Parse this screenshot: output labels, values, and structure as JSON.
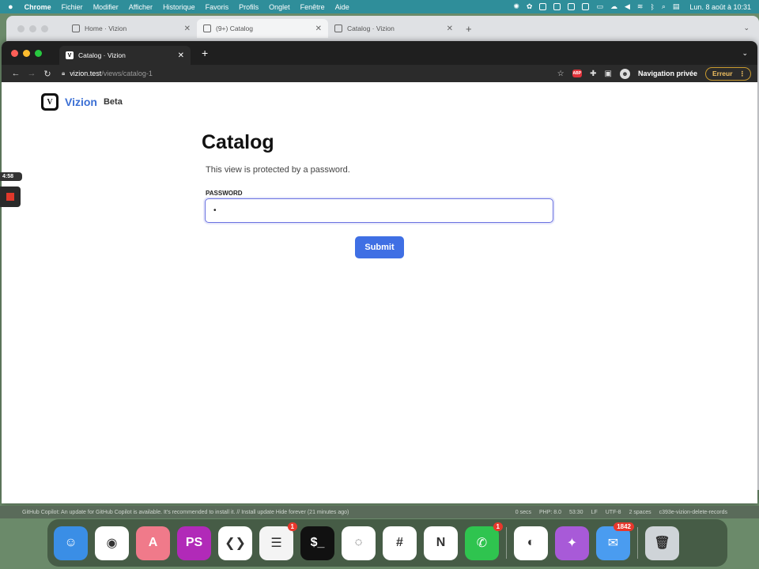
{
  "menubar": {
    "app": "Chrome",
    "items": [
      "Fichier",
      "Modifier",
      "Afficher",
      "Historique",
      "Favoris",
      "Profils",
      "Onglet",
      "Fenêtre",
      "Aide"
    ],
    "clock": "Lun. 8 août à 10:31"
  },
  "back_window": {
    "tabs": [
      {
        "label": "Home · Vizion"
      },
      {
        "label": "(9+) Catalog"
      },
      {
        "label": "Catalog · Vizion"
      }
    ]
  },
  "browser": {
    "tab_label": "Catalog · Vizion",
    "tab_favicon": "V",
    "url_host": "vizion.test",
    "url_path": "/views/catalog-1",
    "abp_label": "ABP",
    "profile_label": "Navigation privée",
    "error_label": "Erreur"
  },
  "page": {
    "brand_logo": "V",
    "brand_name": "Vizion",
    "brand_badge": "Beta",
    "title": "Catalog",
    "description": "This view is protected by a password.",
    "password_label": "PASSWORD",
    "password_value": "•",
    "submit_label": "Submit"
  },
  "recorder": {
    "time": "4:58"
  },
  "ide_status": {
    "message": "GitHub Copilot: An update for GitHub Copilot is available. It's recommended to install it. // Install update   Hide forever (21 minutes ago)",
    "items": [
      "0 secs",
      "PHP: 8.0",
      "53:30",
      "LF",
      "UTF-8",
      "2 spaces",
      "c393e-vizion-delete-records"
    ]
  },
  "dock": {
    "apps": [
      {
        "name": "finder",
        "color": "#3a8ee6",
        "glyph": "☺"
      },
      {
        "name": "chrome",
        "color": "#ffffff",
        "glyph": "◉"
      },
      {
        "name": "appstore-a",
        "color": "#f07a8a",
        "glyph": "A"
      },
      {
        "name": "phpstorm",
        "color": "#b12ab8",
        "glyph": "PS"
      },
      {
        "name": "vscode",
        "color": "#ffffff",
        "glyph": "❮❯"
      },
      {
        "name": "reminders",
        "color": "#f4f4f4",
        "glyph": "☰",
        "badge": "1"
      },
      {
        "name": "terminal",
        "color": "#111111",
        "glyph": "$_"
      },
      {
        "name": "messenger",
        "color": "#ffffff",
        "glyph": "◌"
      },
      {
        "name": "slack",
        "color": "#ffffff",
        "glyph": "#"
      },
      {
        "name": "notion",
        "color": "#ffffff",
        "glyph": "N"
      },
      {
        "name": "whatsapp",
        "color": "#2fc44f",
        "glyph": "✆",
        "badge": "1"
      },
      {
        "name": "alfred",
        "color": "#ffffff",
        "glyph": "◐"
      },
      {
        "name": "altstore",
        "color": "#a85ad8",
        "glyph": "✦"
      },
      {
        "name": "mail",
        "color": "#4a9cf0",
        "glyph": "✉",
        "badge": "1842"
      },
      {
        "name": "trash",
        "color": "#cfd4d8",
        "glyph": "🗑"
      }
    ]
  },
  "colors": {
    "accent": "#3f6fe4",
    "brand": "#3b6fd4",
    "input_focus": "#6a72e0"
  }
}
